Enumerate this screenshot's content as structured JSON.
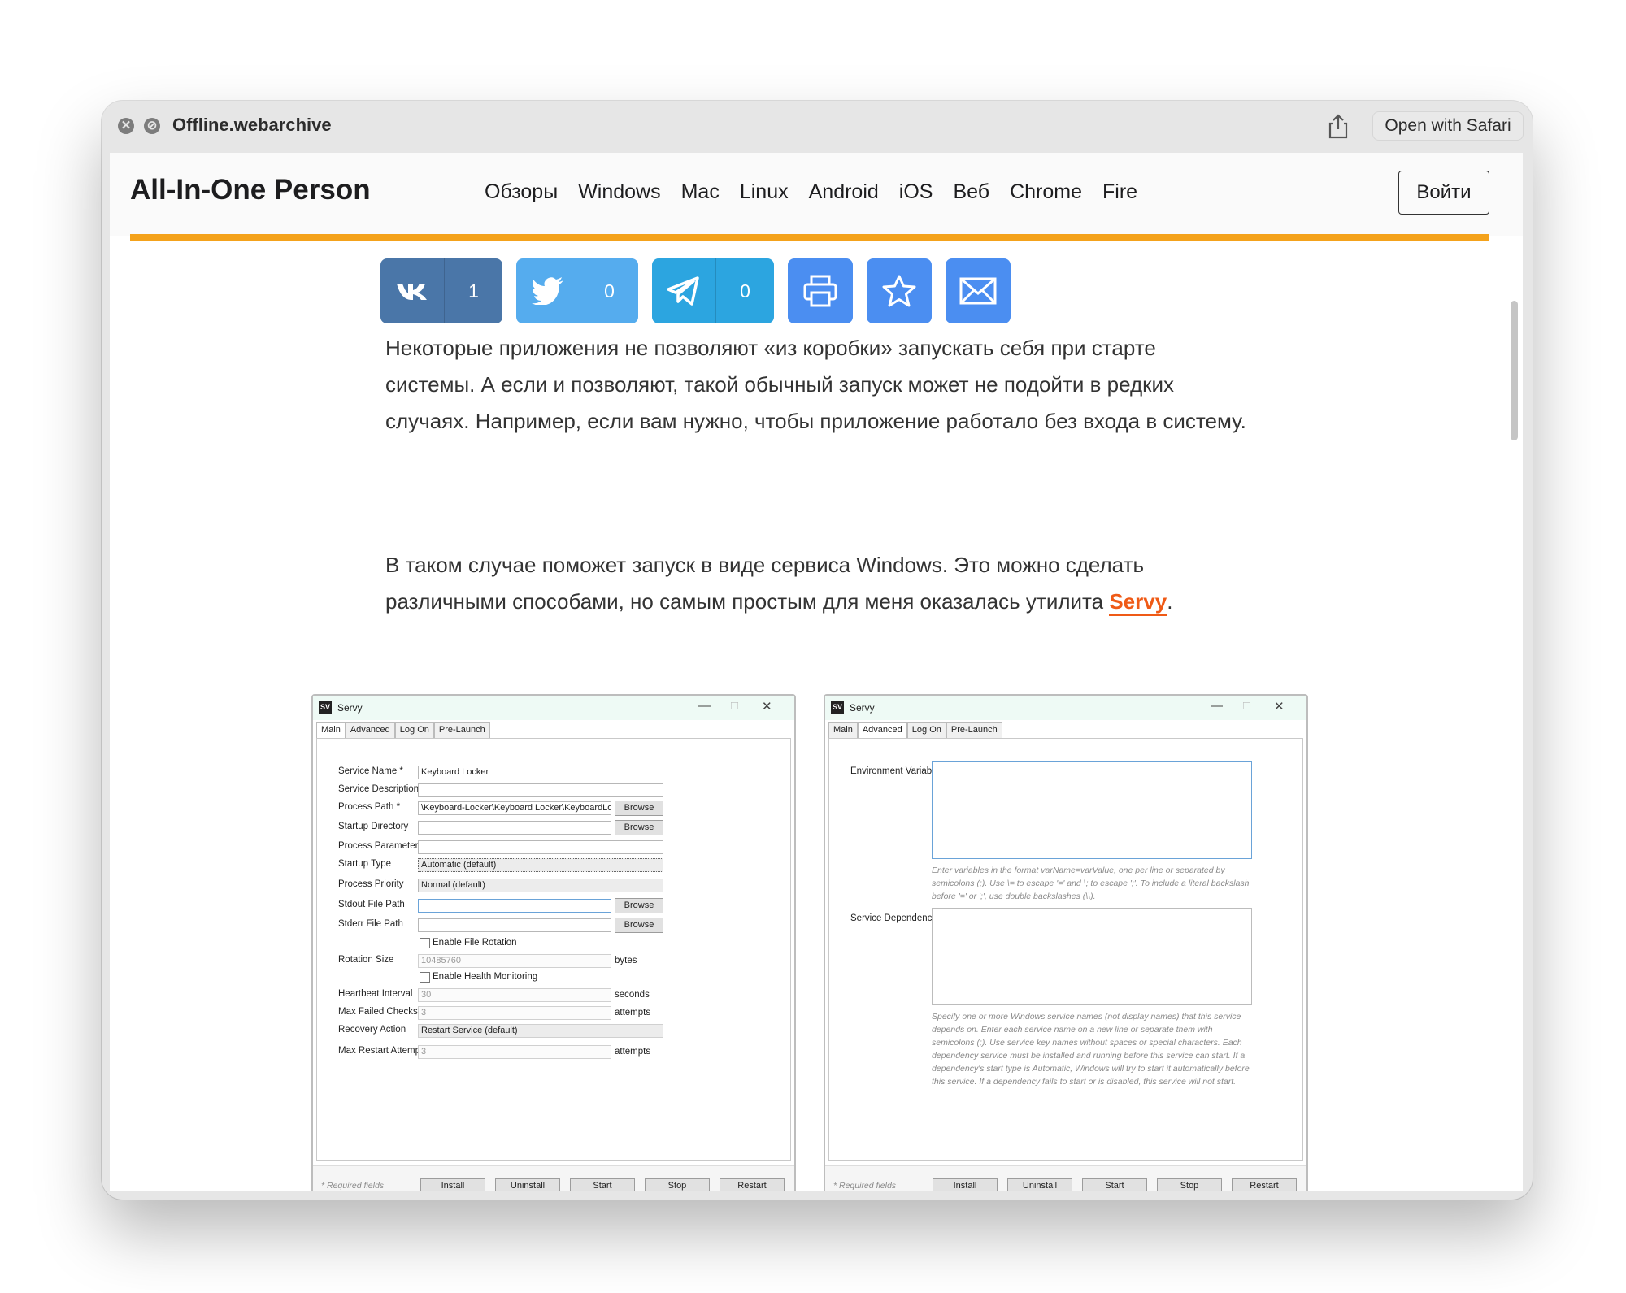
{
  "quicklook": {
    "title": "Offline.webarchive",
    "open_button": "Open with Safari",
    "close_glyph": "✕",
    "hide_glyph": "⊘"
  },
  "site": {
    "brand": "All-In-One Person",
    "nav": [
      "Обзоры",
      "Windows",
      "Mac",
      "Linux",
      "Android",
      "iOS",
      "Веб",
      "Chrome",
      "Fire"
    ],
    "login": "Войти",
    "accent_color": "#f4a21b"
  },
  "share": {
    "vk_count": "1",
    "twitter_count": "0",
    "telegram_count": "0",
    "colors": {
      "vk": "#4a76a8",
      "twitter": "#55acee",
      "telegram": "#2ca5e0",
      "print": "#4b8ef1",
      "fav": "#4b8ef1",
      "mail": "#4b8ef1"
    }
  },
  "article": {
    "p1": "Некоторые приложения не позволяют «из коробки» запускать себя при старте системы. А если и позволяют, такой обычный запуск может не подойти в редких случаях. Например, если вам нужно, чтобы приложение работало без входа в систему.",
    "p2_lead": "В таком случае поможет запуск в виде сервиса Windows. Это можно сделать различными способами, но самым простым для меня оказалась утилита ",
    "p2_link": "Servy",
    "p2_tail": "."
  },
  "servy_main": {
    "window_title": "Servy",
    "logo": "SV",
    "tabs": [
      "Main",
      "Advanced",
      "Log On",
      "Pre-Launch"
    ],
    "labels": {
      "service_name": "Service Name *",
      "service_description": "Service Description",
      "process_path": "Process Path *",
      "startup_directory": "Startup Directory",
      "process_parameters": "Process Parameters",
      "startup_type": "Startup Type",
      "process_priority": "Process Priority",
      "stdout": "Stdout File Path",
      "stderr": "Stderr File Path",
      "enable_rotation": "Enable File Rotation",
      "rotation_size": "Rotation Size",
      "enable_health": "Enable Health Monitoring",
      "heartbeat": "Heartbeat Interval",
      "max_failed": "Max Failed Checks",
      "recovery": "Recovery Action",
      "max_restart": "Max Restart Attempts"
    },
    "values": {
      "service_name": "Keyboard Locker",
      "process_path": "\\Keyboard-Locker\\Keyboard Locker\\KeyboardLocker.exe",
      "startup_type": "Automatic (default)",
      "process_priority": "Normal (default)",
      "rotation_size": "10485760",
      "heartbeat": "30",
      "max_failed": "3",
      "recovery": "Restart Service (default)",
      "max_restart": "3"
    },
    "units": {
      "bytes": "bytes",
      "seconds": "seconds",
      "attempts": "attempts"
    },
    "browse": "Browse",
    "required": "* Required fields",
    "buttons": [
      "Install",
      "Uninstall",
      "Start",
      "Stop",
      "Restart"
    ]
  },
  "servy_adv": {
    "window_title": "Servy",
    "logo": "SV",
    "tabs": [
      "Main",
      "Advanced",
      "Log On",
      "Pre-Launch"
    ],
    "env_label": "Environment Variables",
    "env_hint": "Enter variables in the format varName=varValue, one per line or separated by semicolons (;). Use \\= to escape '=' and \\; to escape ';'. To include a literal backslash before '=' or ';', use double backslashes (\\\\).",
    "dep_label": "Service Dependencies",
    "dep_hint": "Specify one or more Windows service names (not display names) that this service depends on. Enter each service name on a new line or separate them with semicolons (;). Use service key names without spaces or special characters. Each dependency service must be installed and running before this service can start. If a dependency's start type is Automatic, Windows will try to start it automatically before this service. If a dependency fails to start or is disabled, this service will not start.",
    "required": "* Required fields",
    "buttons": [
      "Install",
      "Uninstall",
      "Start",
      "Stop",
      "Restart"
    ]
  }
}
